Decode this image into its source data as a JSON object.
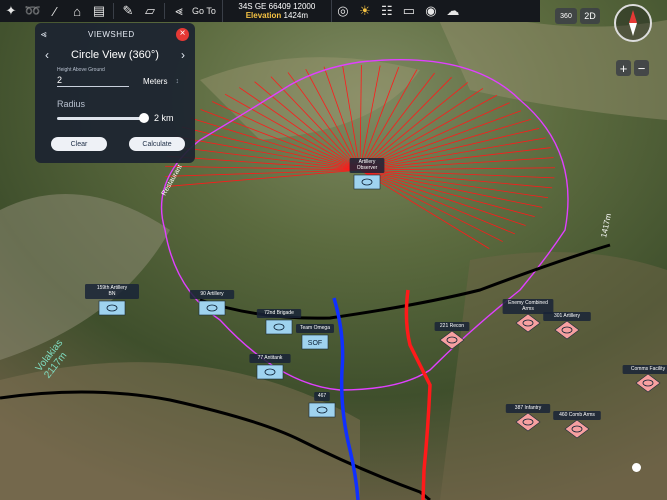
{
  "toolbar": {
    "goto_label": "Go To",
    "coordinate": "34S GE 66409 12000",
    "elevation_label": "Elevation",
    "elevation_value": "1424m",
    "icons_left": [
      "satellite-icon",
      "route-icon",
      "ruler-icon",
      "stamp-icon",
      "layers-icon",
      "pencil-icon",
      "polygon-icon"
    ],
    "icons_right": [
      "globe-icon",
      "sun-icon",
      "network-icon",
      "monitor-icon",
      "target-icon",
      "cloud-icon"
    ]
  },
  "viewshed": {
    "title": "VIEWSHED",
    "mode": "Circle View (360°)",
    "height_label": "Height Above Ground",
    "height_value": "2",
    "height_unit": "Meters",
    "radius_label": "Radius",
    "radius_value": 1.0,
    "radius_text": "2 km",
    "clear_label": "Clear",
    "calculate_label": "Calculate"
  },
  "view_controls": {
    "mode_2d": "2D",
    "zoom_in": "+",
    "zoom_out": "−",
    "view_360": "360"
  },
  "map_labels": [
    {
      "text": "Volakias\n2117m"
    },
    {
      "text": "Restaurant"
    },
    {
      "text": "1417m"
    }
  ],
  "units": [
    {
      "name": "Artillery Observer",
      "side": "friendly"
    },
    {
      "name": "159th Artillery BN",
      "side": "friendly"
    },
    {
      "name": "90 Artillery",
      "side": "friendly"
    },
    {
      "name": "72nd Brigade",
      "side": "friendly"
    },
    {
      "name": "Team Omega",
      "side": "friendly",
      "symbol_text": "SOF"
    },
    {
      "name": "77 Antitank",
      "side": "friendly"
    },
    {
      "name": "467",
      "side": "friendly"
    },
    {
      "name": "221 Recon",
      "side": "hostile"
    },
    {
      "name": "Enemy Combined Arms",
      "side": "hostile"
    },
    {
      "name": "301 Artillery",
      "side": "hostile"
    },
    {
      "name": "Comms Facility",
      "side": "hostile"
    },
    {
      "name": "387 Infantry",
      "side": "hostile"
    },
    {
      "name": "460 Comb Arms",
      "side": "hostile"
    }
  ],
  "colors": {
    "friendly": "#9fd3ef",
    "hostile": "#f7a0a0",
    "viewshed_rays": "#ff1a1a",
    "viewshed_boundary": "#e040ff",
    "blue_line": "#1030ff",
    "red_line": "#ff1a1a",
    "black_line": "#000000"
  }
}
